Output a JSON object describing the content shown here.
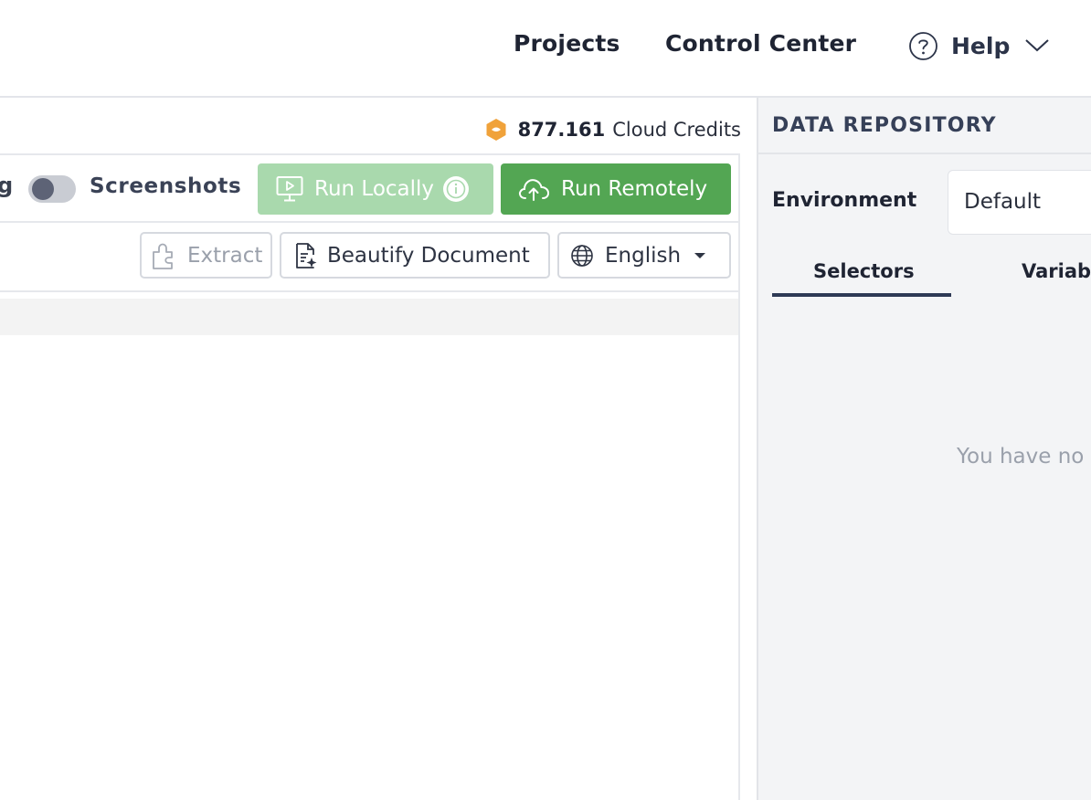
{
  "nav": {
    "projects": "Projects",
    "control_center": "Control Center",
    "help": "Help"
  },
  "credits": {
    "value": "877.161",
    "unit": "Cloud Credits",
    "icon": "cloud-credits-icon",
    "color": "#f0a23a"
  },
  "toolbar": {
    "truncated_label": "g",
    "screenshots_label": "Screenshots",
    "screenshots_enabled": false,
    "run_locally": "Run Locally",
    "run_remotely": "Run Remotely",
    "extract": "Extract",
    "beautify": "Beautify Document",
    "language": "English"
  },
  "repository": {
    "title": "DATA REPOSITORY",
    "environment_label": "Environment",
    "environment_value": "Default",
    "tabs": [
      {
        "label": "Selectors",
        "active": true
      },
      {
        "label": "Variabl",
        "active": false
      }
    ],
    "empty_message": "You have no"
  },
  "colors": {
    "run_remote": "#53a653",
    "run_local": "#a9d9ad",
    "text_dark": "#1f2433"
  }
}
